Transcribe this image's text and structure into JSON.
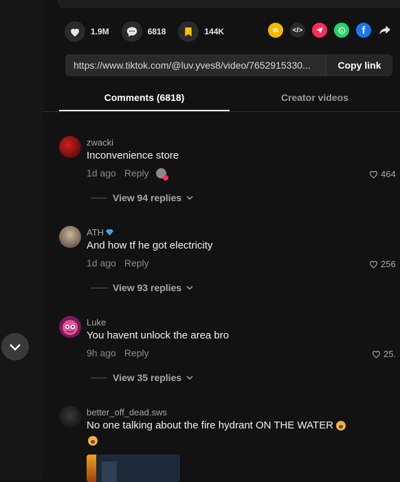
{
  "actions": {
    "likes": "1.9M",
    "comments": "6818",
    "saves": "144K"
  },
  "share_icons": [
    "repost-icon",
    "embed-icon",
    "send-icon",
    "whatsapp-icon",
    "facebook-icon",
    "share-arrow-icon"
  ],
  "link": {
    "url": "https://www.tiktok.com/@luv.yves8/video/7652915330...",
    "copy_label": "Copy link"
  },
  "tabs": {
    "comments": "Comments (6818)",
    "creator": "Creator videos"
  },
  "comments": [
    {
      "user": "zwacki",
      "text": "Inconvenience store",
      "time": "1d ago",
      "reply": "Reply",
      "likes": "464",
      "view_replies": "View 94 replies"
    },
    {
      "user": "ATH",
      "text": "And how tf he got electricity",
      "time": "1d ago",
      "reply": "Reply",
      "likes": "256",
      "view_replies": "View 93 replies"
    },
    {
      "user": "Luke",
      "text": "You havent unlock the area bro",
      "time": "9h ago",
      "reply": "Reply",
      "likes": "25.",
      "view_replies": "View 35 replies"
    },
    {
      "user": "better_off_dead.sws",
      "text": "No one talking about the fire hydrant ON THE WATER"
    }
  ],
  "colors": {
    "background": "#121212",
    "save_yellow": "#f5c400",
    "whatsapp_green": "#25d366",
    "facebook_blue": "#1877f2",
    "send_red": "#fe2c55",
    "repost_yellow": "#f5b800"
  }
}
